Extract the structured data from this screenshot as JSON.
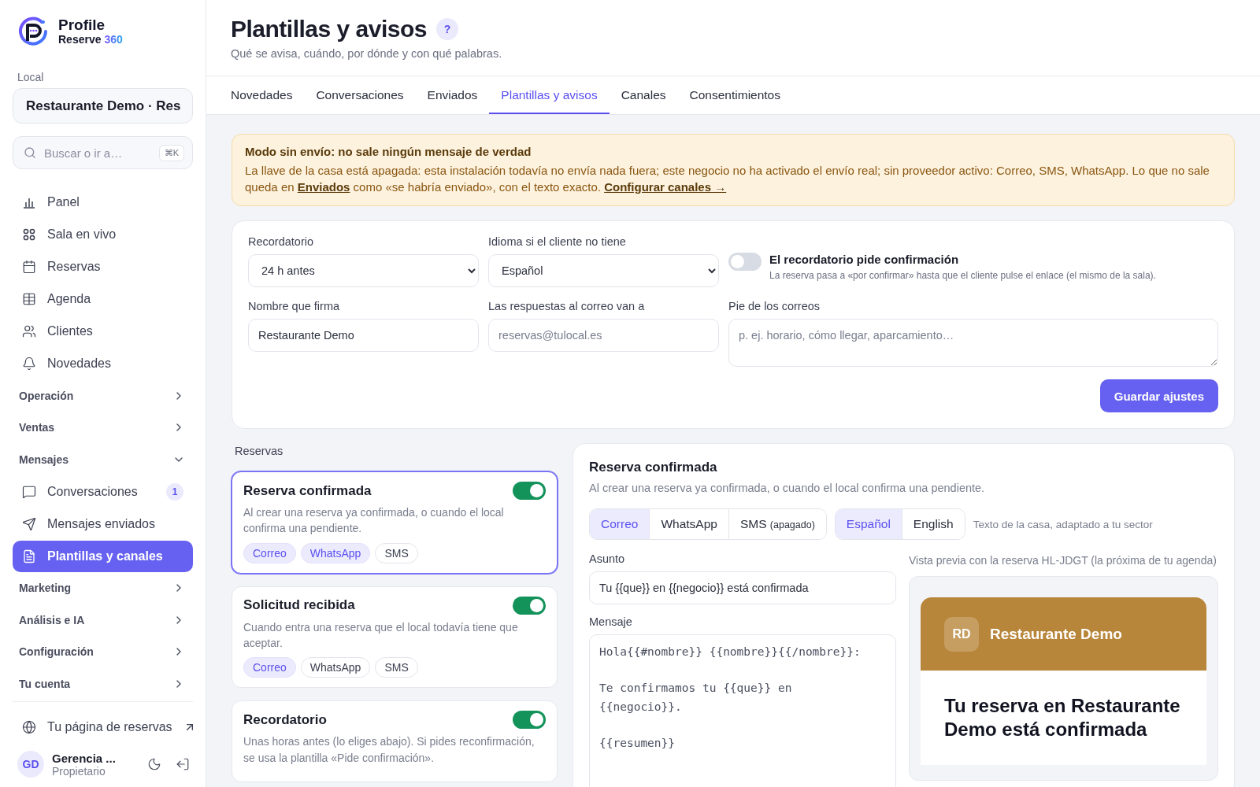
{
  "brand": {
    "name": "Profile",
    "sub": "Reserve",
    "accent": "360"
  },
  "sidebar": {
    "local_label": "Local",
    "local_value": "Restaurante Demo · Res",
    "search": {
      "placeholder": "Buscar o ir a…",
      "shortcut": "⌘K"
    },
    "nav": [
      {
        "label": "Panel",
        "selected": false
      },
      {
        "label": "Sala en vivo",
        "selected": false
      },
      {
        "label": "Reservas",
        "selected": false
      },
      {
        "label": "Agenda",
        "selected": false
      },
      {
        "label": "Clientes",
        "selected": false
      },
      {
        "label": "Novedades",
        "selected": false
      }
    ],
    "groups": [
      {
        "label": "Operación",
        "expanded": false
      },
      {
        "label": "Ventas",
        "expanded": false
      },
      {
        "label": "Mensajes",
        "expanded": true,
        "children": [
          {
            "label": "Conversaciones",
            "badge": "1",
            "selected": false
          },
          {
            "label": "Mensajes enviados",
            "selected": false
          },
          {
            "label": "Plantillas y canales",
            "selected": true
          }
        ]
      },
      {
        "label": "Marketing",
        "expanded": false
      },
      {
        "label": "Análisis e IA",
        "expanded": false
      },
      {
        "label": "Configuración",
        "expanded": false
      },
      {
        "label": "Tu cuenta",
        "expanded": false
      }
    ],
    "booking_link": "Tu página de reservas",
    "user": {
      "initials": "GD",
      "name": "Gerencia ...",
      "role": "Propietario"
    }
  },
  "header": {
    "title": "Plantillas y avisos",
    "help": "?",
    "subtitle": "Qué se avisa, cuándo, por dónde y con qué palabras."
  },
  "tabs": [
    {
      "label": "Novedades",
      "selected": false
    },
    {
      "label": "Conversaciones",
      "selected": false
    },
    {
      "label": "Enviados",
      "selected": false
    },
    {
      "label": "Plantillas y avisos",
      "selected": true
    },
    {
      "label": "Canales",
      "selected": false
    },
    {
      "label": "Consentimientos",
      "selected": false
    }
  ],
  "notice": {
    "title": "Modo sin envío: no sale ningún mensaje de verdad",
    "text_1": "La llave de la casa está apagada: esta instalación todavía no envía nada fuera; este negocio no ha activado el envío real; sin proveedor activo: Correo, SMS, WhatsApp. Lo que no sale queda en",
    "link_1": "Enviados",
    "text_2": "como «se habría enviado», con el texto exacto.",
    "link_2": "Configurar canales →"
  },
  "settings": {
    "reminder": {
      "label": "Recordatorio",
      "value": "24 h antes"
    },
    "language": {
      "label": "Idioma si el cliente no tiene",
      "value": "Español"
    },
    "confirm_toggle": {
      "label": "El recordatorio pide confirmación",
      "hint": "La reserva pasa a «por confirmar» hasta que el cliente pulse el enlace (el mismo de la sala).",
      "on": false
    },
    "signer": {
      "label": "Nombre que firma",
      "value": "Restaurante Demo"
    },
    "reply_to": {
      "label": "Las respuestas al correo van a",
      "placeholder": "reservas@tulocal.es"
    },
    "footer": {
      "label": "Pie de los correos",
      "placeholder": "p. ej. horario, cómo llegar, aparcamiento…"
    },
    "save": "Guardar ajustes"
  },
  "section_label": "Reservas",
  "templates": [
    {
      "title": "Reserva confirmada",
      "desc": "Al crear una reserva ya confirmada, o cuando el local confirma una pendiente.",
      "on": true,
      "selected": true,
      "channels": [
        {
          "label": "Correo",
          "on": true
        },
        {
          "label": "WhatsApp",
          "on": true
        },
        {
          "label": "SMS",
          "on": false
        }
      ]
    },
    {
      "title": "Solicitud recibida",
      "desc": "Cuando entra una reserva que el local todavía tiene que aceptar.",
      "on": true,
      "selected": false,
      "channels": [
        {
          "label": "Correo",
          "on": true
        },
        {
          "label": "WhatsApp",
          "on": false
        },
        {
          "label": "SMS",
          "on": false
        }
      ]
    },
    {
      "title": "Recordatorio",
      "desc": "Unas horas antes (lo eliges abajo). Si pides reconfirmación, se usa la plantilla «Pide confirmación».",
      "on": true,
      "selected": false
    }
  ],
  "editor": {
    "title": "Reserva confirmada",
    "desc": "Al crear una reserva ya confirmada, o cuando el local confirma una pendiente.",
    "channel_tabs": [
      {
        "label": "Correo",
        "selected": true
      },
      {
        "label": "WhatsApp",
        "selected": false
      },
      {
        "label": "SMS",
        "note": "(apagado)",
        "selected": false
      }
    ],
    "lang_tabs": [
      {
        "label": "Español",
        "selected": true
      },
      {
        "label": "English",
        "selected": false
      }
    ],
    "hint": "Texto de la casa, adaptado a tu sector",
    "subject": {
      "label": "Asunto",
      "value": "Tu {{que}} en {{negocio}} está confirmada"
    },
    "message": {
      "label": "Mensaje",
      "value": "Hola{{#nombre}} {{nombre}}{{/nombre}}:\n\nTe confirmamos tu {{que}} en\n{{negocio}}.\n\n{{resumen}}"
    },
    "preview_caption": "Vista previa con la reserva HL-JDGT (la próxima de tu agenda)",
    "preview": {
      "initials": "RD",
      "name": "Restaurante Demo",
      "heading": "Tu reserva en Restaurante Demo está confirmada"
    }
  }
}
